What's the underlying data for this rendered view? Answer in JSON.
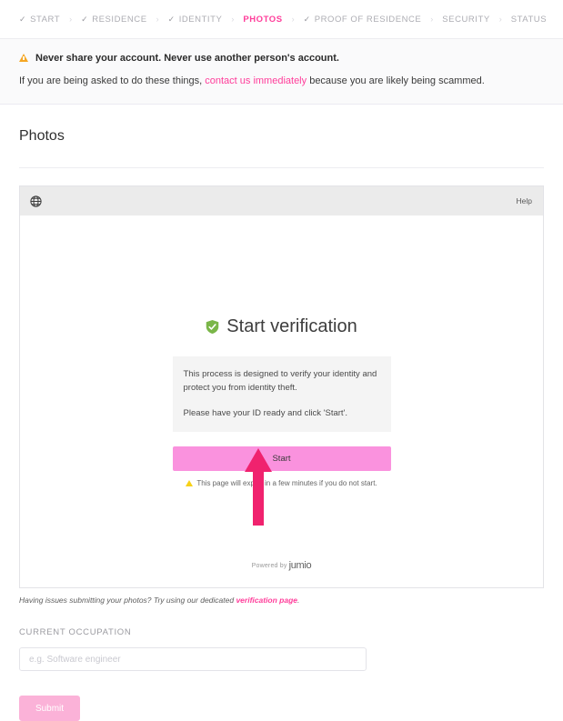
{
  "stepper": {
    "separator": "›",
    "check_glyph": "✓",
    "steps": [
      {
        "label": "START",
        "done": true,
        "current": false
      },
      {
        "label": "RESIDENCE",
        "done": true,
        "current": false
      },
      {
        "label": "IDENTITY",
        "done": true,
        "current": false
      },
      {
        "label": "PHOTOS",
        "done": false,
        "current": true
      },
      {
        "label": "PROOF OF RESIDENCE",
        "done": true,
        "current": false
      },
      {
        "label": "SECURITY",
        "done": false,
        "current": false
      },
      {
        "label": "STATUS",
        "done": false,
        "current": false
      }
    ]
  },
  "banner": {
    "headline": "Never share your account. Never use another person's account.",
    "body_before": "If you are being asked to do these things, ",
    "link": "contact us immediately",
    "body_after": " because you are likely being scammed."
  },
  "page": {
    "title": "Photos"
  },
  "frame": {
    "help_label": "Help",
    "heading": "Start verification",
    "info_paragraph_1": "This process is designed to verify your identity and protect you from identity theft.",
    "info_paragraph_2": "Please have your ID ready and click 'Start'.",
    "start_label": "Start",
    "expire_notice": "This page will expire in a few minutes if you do not start.",
    "powered_prefix": "Powered by",
    "powered_brand": "jumio"
  },
  "helper": {
    "text_before": "Having issues submitting your photos? Try using our dedicated ",
    "link": "verification page",
    "text_after": "."
  },
  "occupation": {
    "label": "CURRENT OCCUPATION",
    "placeholder": "e.g. Software engineer",
    "value": ""
  },
  "submit": {
    "label": "Submit"
  },
  "colors": {
    "accent_pink": "#ff3d9a",
    "start_button": "#fa92de",
    "submit_button": "#fbb2d8",
    "arrow": "#f0226e",
    "shield_green": "#7ab648",
    "warning_amber": "#f5a623"
  }
}
